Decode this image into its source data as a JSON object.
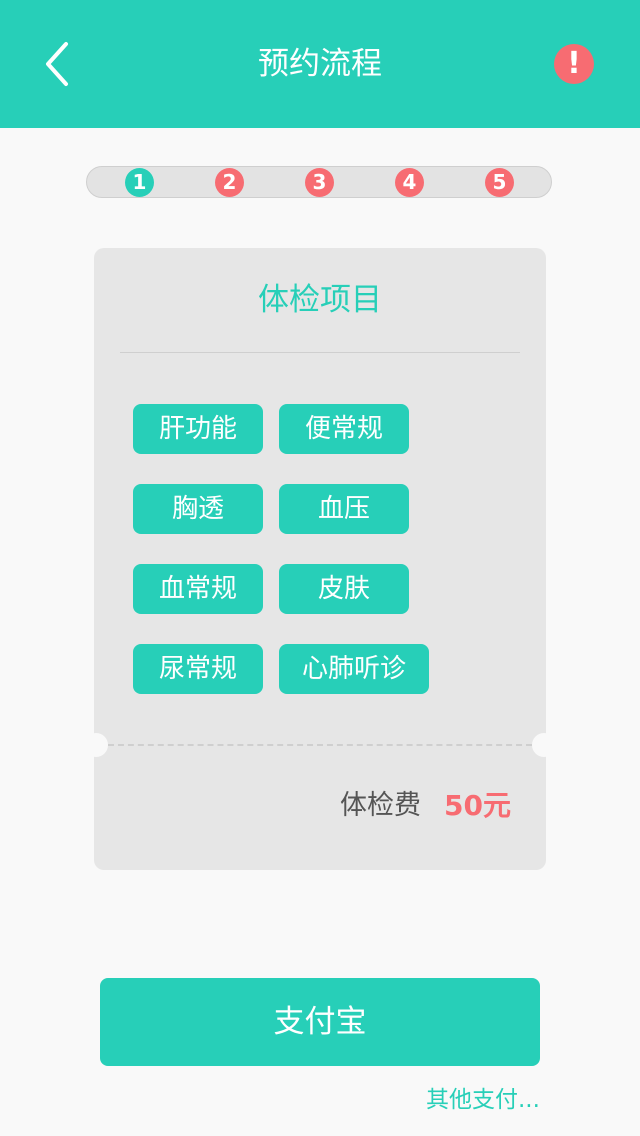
{
  "header": {
    "title": "预约流程",
    "alert_label": "!"
  },
  "steps": [
    "1",
    "2",
    "3",
    "4",
    "5"
  ],
  "card": {
    "title": "体检项目",
    "items": [
      "肝功能",
      "便常规",
      "胸透",
      "血压",
      "血常规",
      "皮肤",
      "尿常规",
      "心肺听诊"
    ],
    "fee_label": "体检费",
    "fee_value": "50元"
  },
  "payment": {
    "primary_label": "支付宝",
    "other_label": "其他支付..."
  },
  "colors": {
    "accent": "#27cfb8",
    "alert": "#f76c72",
    "card_bg": "#e6e6e6",
    "page_bg": "#f9f9f9"
  }
}
